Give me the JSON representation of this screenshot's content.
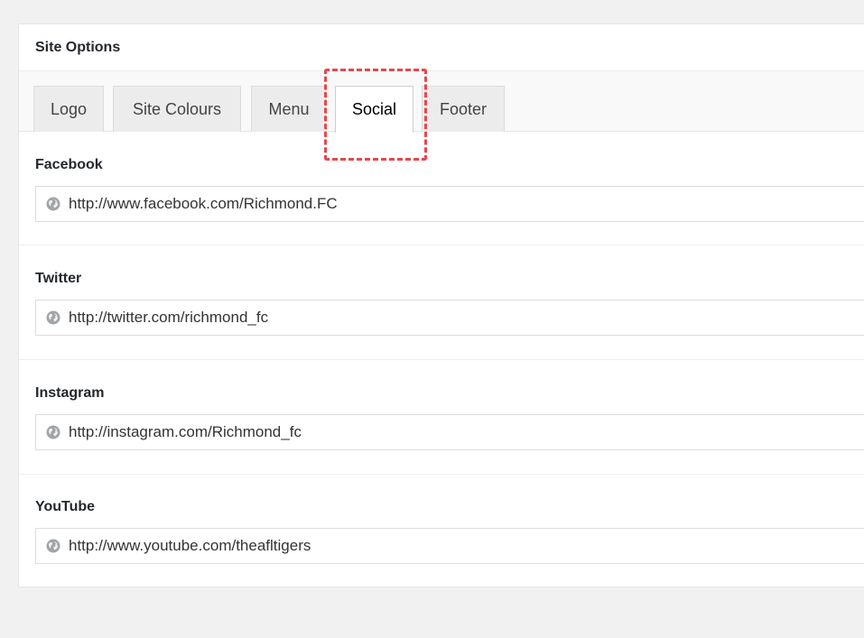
{
  "panel": {
    "title": "Site Options"
  },
  "tabs": [
    {
      "label": "Logo"
    },
    {
      "label": "Site Colours"
    },
    {
      "label": "Menu"
    },
    {
      "label": "Social",
      "active": true
    },
    {
      "label": "Footer"
    }
  ],
  "fields": [
    {
      "label": "Facebook",
      "value": "http://www.facebook.com/Richmond.FC",
      "icon": "globe-icon"
    },
    {
      "label": "Twitter",
      "value": "http://twitter.com/richmond_fc",
      "icon": "globe-icon"
    },
    {
      "label": "Instagram",
      "value": "http://instagram.com/Richmond_fc",
      "icon": "globe-icon"
    },
    {
      "label": "YouTube",
      "value": "http://www.youtube.com/theafltigers",
      "icon": "globe-icon"
    }
  ],
  "colors": {
    "highlight": "#e5484d",
    "panel_bg": "#ffffff",
    "page_bg": "#f1f1f1"
  }
}
